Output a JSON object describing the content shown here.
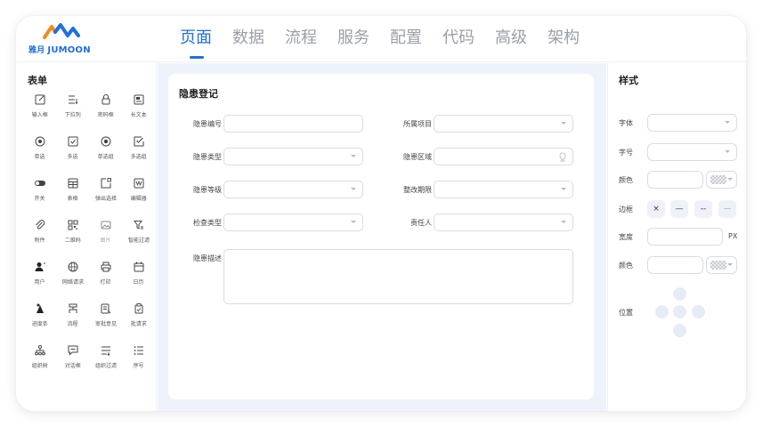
{
  "brand": {
    "logo_cn": "雅月",
    "logo_en": "JUMOON",
    "accent": "#1f6fe0"
  },
  "nav": [
    {
      "label": "页面",
      "active": true
    },
    {
      "label": "数据"
    },
    {
      "label": "流程"
    },
    {
      "label": "服务"
    },
    {
      "label": "配置"
    },
    {
      "label": "代码"
    },
    {
      "label": "高级"
    },
    {
      "label": "架构"
    }
  ],
  "palette": {
    "title": "表单",
    "widgets": [
      {
        "label": "输入框",
        "icon": "edit-icon"
      },
      {
        "label": "下拉列",
        "icon": "dropdown-list-icon"
      },
      {
        "label": "密码框",
        "icon": "lock-icon"
      },
      {
        "label": "长文本",
        "icon": "long-text-icon"
      },
      {
        "label": "单选",
        "icon": "radio-icon"
      },
      {
        "label": "多选",
        "icon": "checkbox-icon"
      },
      {
        "label": "单选组",
        "icon": "radio-group-icon"
      },
      {
        "label": "多选组",
        "icon": "checkbox-group-icon"
      },
      {
        "label": "开关",
        "icon": "toggle-icon"
      },
      {
        "label": "表格",
        "icon": "table-icon"
      },
      {
        "label": "弹出选择",
        "icon": "popup-select-icon"
      },
      {
        "label": "编辑器",
        "icon": "editor-icon"
      },
      {
        "label": "附件",
        "icon": "paperclip-icon"
      },
      {
        "label": "二维码",
        "icon": "qrcode-icon"
      },
      {
        "label": "图片",
        "icon": "image-icon",
        "light": true
      },
      {
        "label": "智能过滤",
        "icon": "smart-filter-icon"
      },
      {
        "label": "用户",
        "icon": "user-icon"
      },
      {
        "label": "网络请求",
        "icon": "globe-icon"
      },
      {
        "label": "打印",
        "icon": "printer-icon"
      },
      {
        "label": "日历",
        "icon": "calendar-icon"
      },
      {
        "label": "进度条",
        "icon": "progress-icon"
      },
      {
        "label": "流程",
        "icon": "flow-icon"
      },
      {
        "label": "审批意见",
        "icon": "approval-comment-icon"
      },
      {
        "label": "批请求",
        "icon": "clipboard-check-icon"
      },
      {
        "label": "组织树",
        "icon": "org-tree-icon"
      },
      {
        "label": "对话框",
        "icon": "dialog-icon"
      },
      {
        "label": "组织过滤",
        "icon": "org-filter-icon"
      },
      {
        "label": "序号",
        "icon": "list-number-icon"
      }
    ]
  },
  "form": {
    "title": "隐患登记",
    "fields": {
      "hazard_no": {
        "label": "隐患编号",
        "value": ""
      },
      "project": {
        "label": "所属项目",
        "value": ""
      },
      "hazard_type": {
        "label": "隐患类型",
        "value": ""
      },
      "hazard_area": {
        "label": "隐患区域",
        "value": ""
      },
      "hazard_level": {
        "label": "隐患等级",
        "value": ""
      },
      "deadline": {
        "label": "整改期限",
        "value": ""
      },
      "check_type": {
        "label": "检查类型",
        "value": ""
      },
      "owner": {
        "label": "责任人",
        "value": ""
      },
      "description": {
        "label": "隐患描述",
        "value": ""
      }
    }
  },
  "style_panel": {
    "title": "样式",
    "font_label": "字体",
    "size_label": "字号",
    "color_label": "颜色",
    "border_label": "边框",
    "border_options": [
      "×",
      "—",
      "--",
      "····"
    ],
    "width_label": "宽度",
    "width_unit": "PX",
    "color2_label": "颜色",
    "position_label": "位置"
  }
}
